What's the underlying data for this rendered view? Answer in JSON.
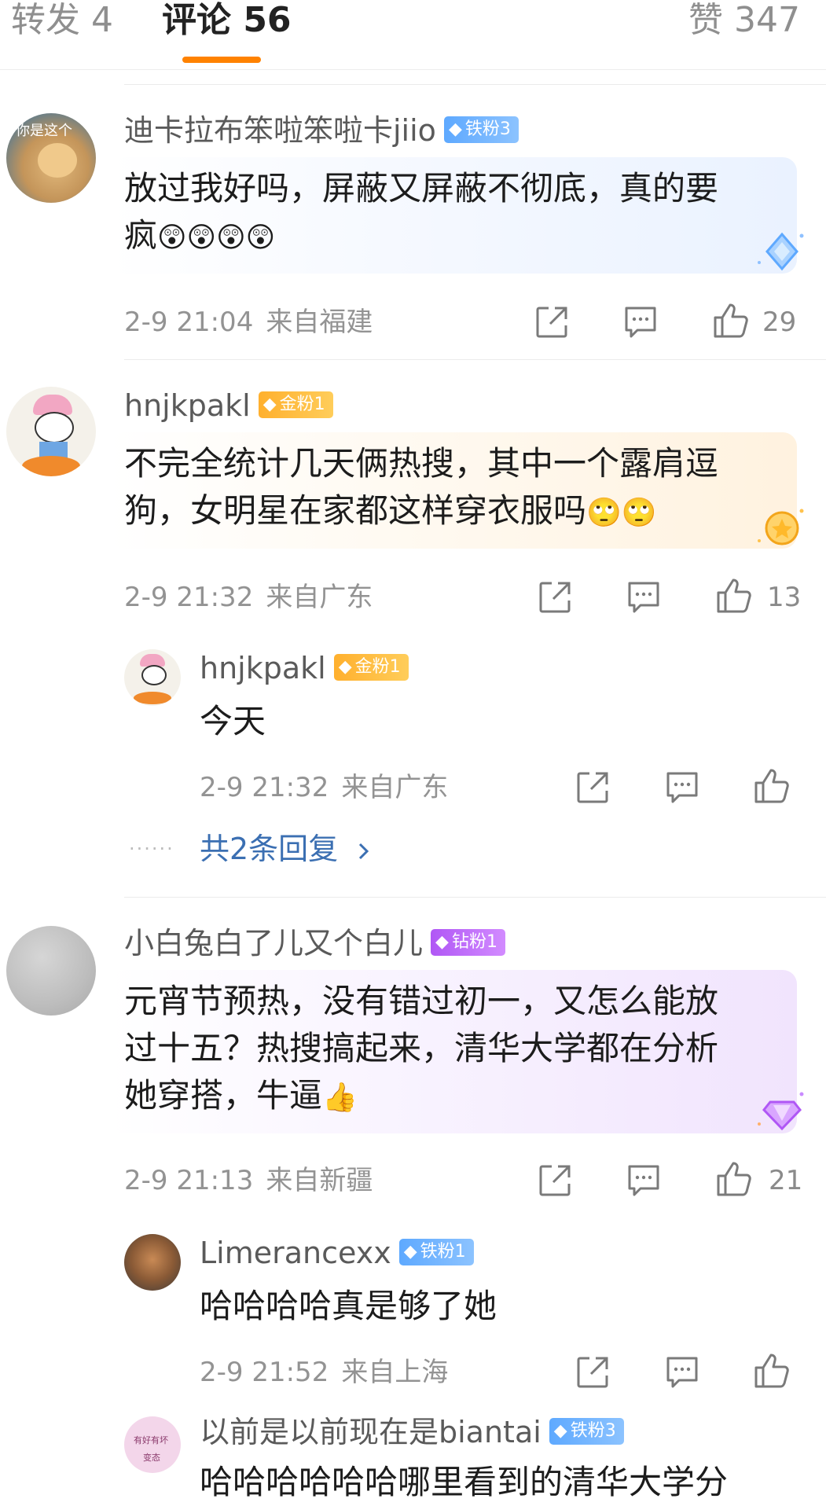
{
  "tabs": [
    {
      "label": "转发 4"
    },
    {
      "label": "评论 56"
    },
    {
      "label": "赞 347"
    }
  ],
  "comments": [
    {
      "user": "迪卡拉布笨啦笨啦卡jiio",
      "badge": "铁粉3",
      "avatar_text": "你是这个",
      "lines": [
        "放过我好吗，屏蔽又屏蔽不彻底，真的要",
        "疯"
      ],
      "emojis": "😲😲😲😲",
      "date": "2-9 21:04",
      "location": "来自福建",
      "likes": "29"
    },
    {
      "user": "hnjkpakl",
      "badge": "金粉1",
      "lines": [
        "不完全统计几天俩热搜，其中一个露肩逗",
        "狗，女明星在家都这样穿衣服吗"
      ],
      "emojis": "🙄🙄",
      "date": "2-9 21:32",
      "location": "来自广东",
      "likes": "13",
      "reply": {
        "user": "hnjkpakl",
        "badge": "金粉1",
        "text": "今天",
        "date": "2-9 21:32",
        "location": "来自广东"
      },
      "more_replies": "共2条回复"
    },
    {
      "user": "小白兔白了儿又个白儿",
      "badge": "钻粉1",
      "lines": [
        "元宵节预热，没有错过初一，又怎么能放",
        "过十五？热搜搞起来，清华大学都在分析",
        "她穿搭，牛逼"
      ],
      "emojis": "👍",
      "date": "2-9 21:13",
      "location": "来自新疆",
      "likes": "21",
      "replies": [
        {
          "user": "Limerancexx",
          "badge": "铁粉1",
          "text": "哈哈哈哈真是够了她",
          "date": "2-9 21:52",
          "location": "来自上海"
        },
        {
          "user": "以前是以前现在是biantai",
          "badge": "铁粉3",
          "avatar_lines": [
            "有好有坏",
            "变态"
          ],
          "text": "哈哈哈哈哈哈哪里看到的清华大学分"
        }
      ]
    }
  ],
  "colors": {
    "accent": "#ff8200",
    "link": "#3b6fb2",
    "iron": "#5ea9ff",
    "gold": "#ffb02e",
    "diamond": "#b057f5"
  },
  "icons": [
    "repost-icon",
    "comment-icon",
    "like-icon",
    "chevron-right-icon",
    "gem-icon"
  ]
}
